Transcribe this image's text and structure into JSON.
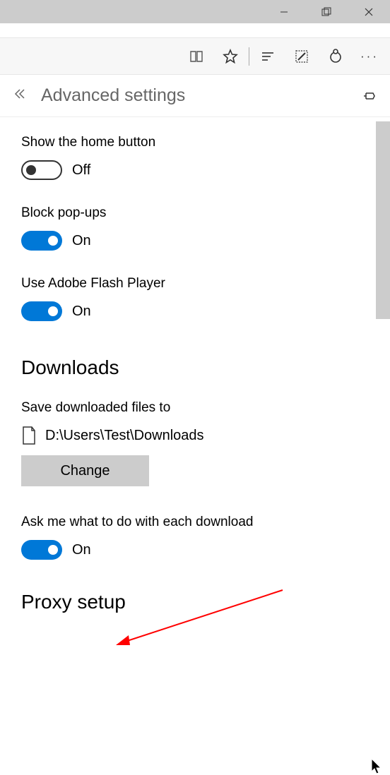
{
  "titlebar": {
    "minimize": "",
    "maximize": "",
    "close": ""
  },
  "panel": {
    "title": "Advanced settings"
  },
  "settings": {
    "home_button": {
      "label": "Show the home button",
      "state": "Off"
    },
    "popups": {
      "label": "Block pop-ups",
      "state": "On"
    },
    "flash": {
      "label": "Use Adobe Flash Player",
      "state": "On"
    }
  },
  "downloads": {
    "header": "Downloads",
    "save_label": "Save downloaded files to",
    "path": "D:\\Users\\Test\\Downloads",
    "change_label": "Change",
    "ask_label": "Ask me what to do with each download",
    "ask_state": "On"
  },
  "proxy": {
    "header": "Proxy setup"
  }
}
